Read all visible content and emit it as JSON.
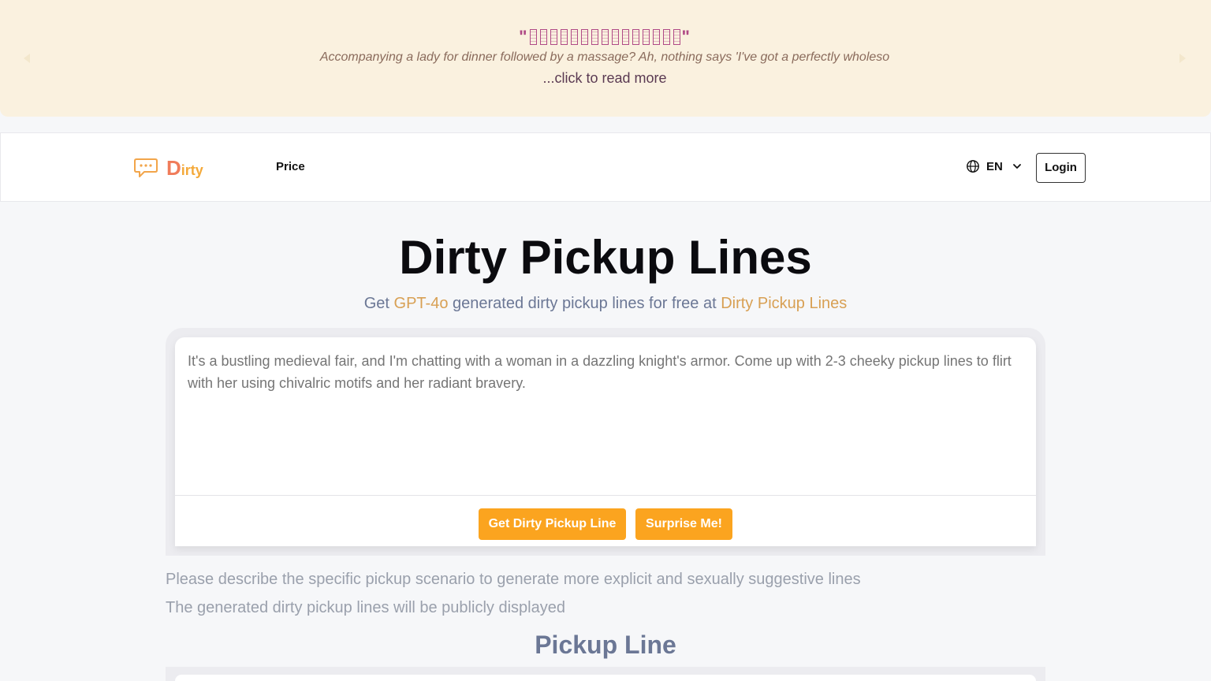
{
  "banner": {
    "title_open": "\"",
    "title_close": "\"",
    "title_glyph_count": 15,
    "quote": "Accompanying a lady for dinner followed by a massage? Ah, nothing says 'I've got a perfectly wholeso",
    "read_more": "...click to read more"
  },
  "header": {
    "logo_initial": "D",
    "logo_rest": "irty",
    "nav_price": "Price",
    "language": "EN",
    "login": "Login"
  },
  "hero": {
    "title": "Dirty Pickup Lines",
    "sub_pre": "Get ",
    "sub_accent1": "GPT-4o",
    "sub_mid": " generated dirty pickup lines for free at ",
    "sub_accent2": "Dirty Pickup Lines"
  },
  "input": {
    "placeholder": "It's a bustling medieval fair, and I'm chatting with a woman in a dazzling knight's armor. Come up with 2-3 cheeky pickup lines to flirt with her using chivalric motifs and her radiant bravery.",
    "get_button": "Get Dirty Pickup Line",
    "surprise_button": "Surprise Me!"
  },
  "notes": {
    "line1": "Please describe the specific pickup scenario to generate more explicit and sexually suggestive lines",
    "line2": "The generated dirty pickup lines will be publicly displayed"
  },
  "result": {
    "title": "Pickup Line"
  },
  "colors": {
    "banner_bg": "#faf1df",
    "accent_orange": "#fba41f",
    "accent_gold": "#d8a054",
    "banner_title": "#b04a86"
  }
}
